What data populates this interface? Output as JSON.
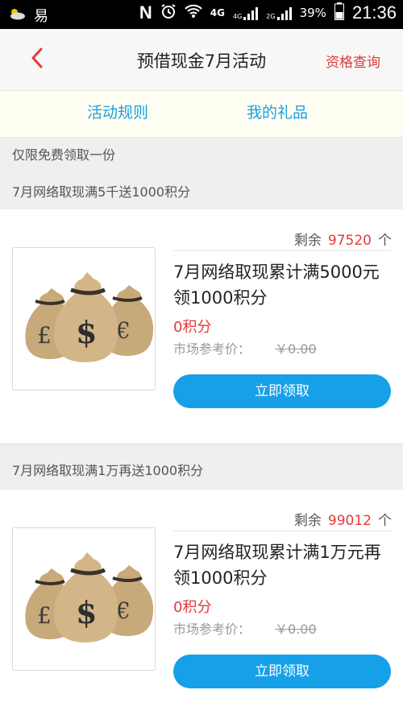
{
  "status_bar": {
    "carrier_glyph": "易",
    "network_4g": "4G",
    "network_4g_small": "4G",
    "network_2g": "2G",
    "battery": "39%",
    "time": "21:36"
  },
  "nav": {
    "title": "预借现金7月活动",
    "query_label": "资格查询"
  },
  "tabs": [
    "活动规则",
    "我的礼品"
  ],
  "notice": {
    "line1": "仅限免费领取一份",
    "line2": "7月网络取现满5千送1000积分"
  },
  "cards": [
    {
      "remain_label": "剩余",
      "remain_count": "97520",
      "remain_unit": "个",
      "name": "7月网络取现累计满5000元领1000积分",
      "points": "0积分",
      "price_label": "市场参考价：",
      "price_value": "￥0.00",
      "button_label": "立即领取"
    },
    {
      "remain_label": "剩余",
      "remain_count": "99012",
      "remain_unit": "个",
      "name": "7月网络取现累计满1万元再领1000积分",
      "points": "0积分",
      "price_label": "市场参考价：",
      "price_value": "￥0.00",
      "button_label": "立即领取"
    }
  ],
  "section2_title": "7月网络取现满1万再送1000积分",
  "colors": {
    "accent_red": "#e2393b",
    "accent_blue": "#16a0e8",
    "tab_blue": "#1aa0e0"
  }
}
